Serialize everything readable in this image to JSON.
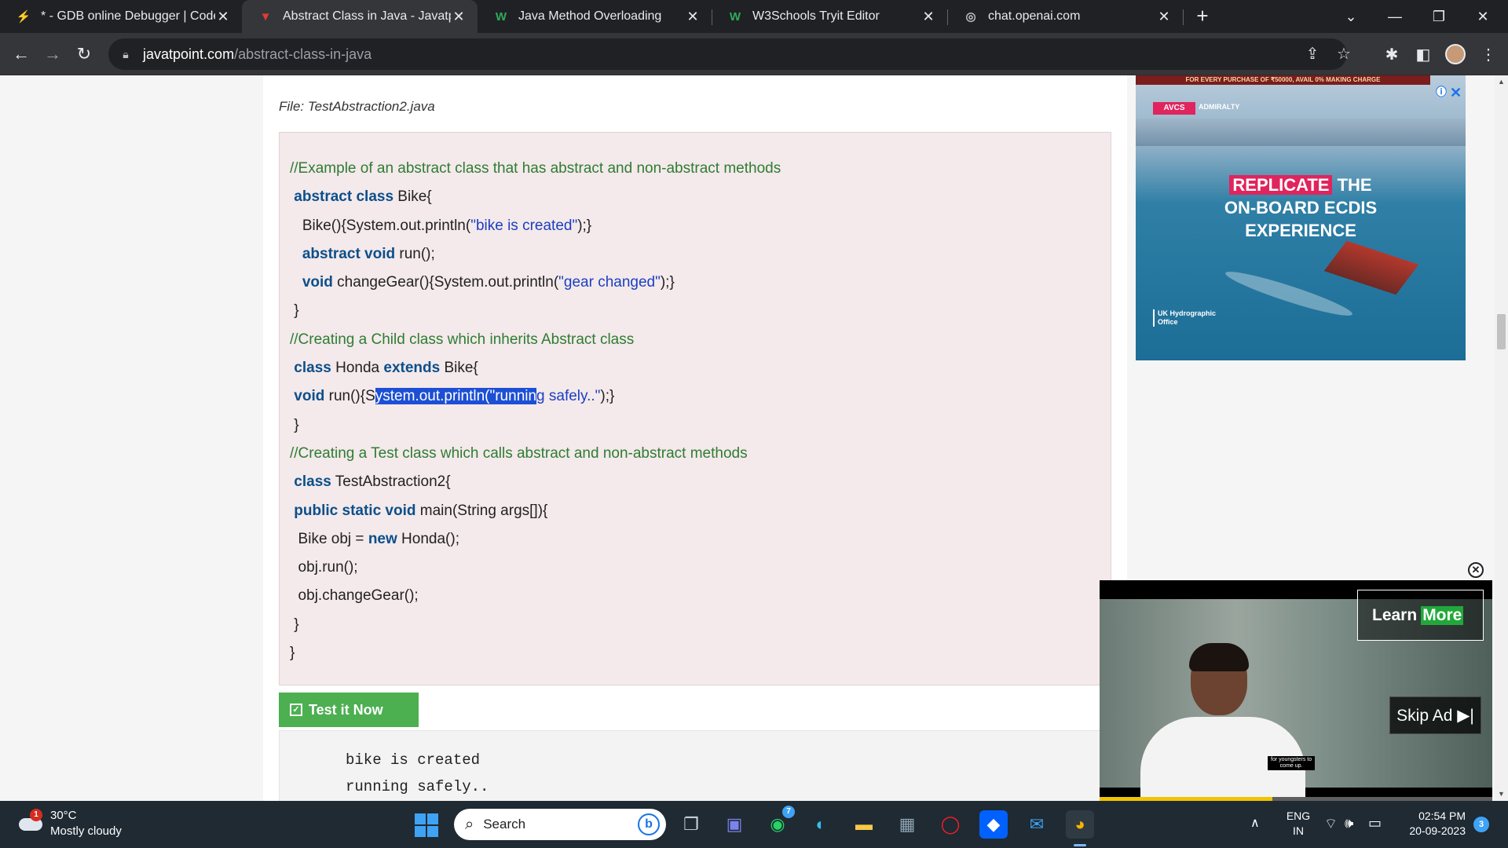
{
  "browser": {
    "tabs": [
      {
        "title": "* - GDB online Debugger | Code, Compile, Run",
        "icon": "lightning-icon",
        "active": false
      },
      {
        "title": "Abstract Class in Java - Javatpoint",
        "icon": "javatpoint-icon",
        "active": true
      },
      {
        "title": "Java Method Overloading",
        "icon": "w3schools-icon",
        "active": false
      },
      {
        "title": "W3Schools Tryit Editor",
        "icon": "w3schools-icon",
        "active": false
      },
      {
        "title": "chat.openai.com",
        "icon": "openai-icon",
        "active": false
      }
    ],
    "url_host": "javatpoint.com",
    "url_path": "/abstract-class-in-java"
  },
  "page": {
    "file_label": "File: TestAbstraction2.java",
    "code_lines": [
      [
        {
          "t": "//Example of an abstract class that has abstract and non-abstract methods",
          "c": "cm"
        }
      ],
      [
        {
          "t": " "
        },
        {
          "t": "abstract class",
          "c": "kw"
        },
        {
          "t": " Bike{"
        }
      ],
      [
        {
          "t": "   Bike(){System.out.println("
        },
        {
          "t": "\"bike is created\"",
          "c": "st"
        },
        {
          "t": ");}"
        }
      ],
      [
        {
          "t": "   "
        },
        {
          "t": "abstract void",
          "c": "kw"
        },
        {
          "t": " run();"
        }
      ],
      [
        {
          "t": "   "
        },
        {
          "t": "void",
          "c": "kw"
        },
        {
          "t": " changeGear(){System.out.println("
        },
        {
          "t": "\"gear changed\"",
          "c": "st"
        },
        {
          "t": ");}"
        }
      ],
      [
        {
          "t": " }"
        }
      ],
      [
        {
          "t": "//Creating a Child class which inherits Abstract class",
          "c": "cm"
        }
      ],
      [
        {
          "t": " "
        },
        {
          "t": "class",
          "c": "kw"
        },
        {
          "t": " Honda "
        },
        {
          "t": "extends",
          "c": "kw"
        },
        {
          "t": " Bike{"
        }
      ],
      [
        {
          "t": " "
        },
        {
          "t": "void",
          "c": "kw"
        },
        {
          "t": " run(){S"
        },
        {
          "t": "ystem.out.println(\"runnin",
          "c": "sel"
        },
        {
          "t": "g safely..\"",
          "c": "st"
        },
        {
          "t": ");}"
        }
      ],
      [
        {
          "t": " }"
        }
      ],
      [
        {
          "t": "//Creating a Test class which calls abstract and non-abstract methods",
          "c": "cm"
        }
      ],
      [
        {
          "t": " "
        },
        {
          "t": "class",
          "c": "kw"
        },
        {
          "t": " TestAbstraction2{"
        }
      ],
      [
        {
          "t": " "
        },
        {
          "t": "public static void",
          "c": "kw"
        },
        {
          "t": " main(String args[]){"
        }
      ],
      [
        {
          "t": "  Bike obj = "
        },
        {
          "t": "new",
          "c": "kw"
        },
        {
          "t": " Honda();"
        }
      ],
      [
        {
          "t": "  obj.run();"
        }
      ],
      [
        {
          "t": "  obj.changeGear();"
        }
      ],
      [
        {
          "t": " }"
        }
      ],
      [
        {
          "t": "}"
        }
      ]
    ],
    "test_button": "Test it Now",
    "output_lines": [
      "bike is created",
      "running safely.."
    ]
  },
  "ads": {
    "banner": {
      "top_strip": "FOR EVERY PURCHASE OF ₹50000, AVAIL 0% MAKING CHARGE",
      "logo": "AVCS",
      "logo_sub": "ADMIRALTY",
      "headline_highlight": "REPLICATE",
      "headline_rest_1": " THE",
      "headline_2": "ON-BOARD ECDIS",
      "headline_3": "EXPERIENCE",
      "footer_1": "UK Hydrographic",
      "footer_2": "Office",
      "adchoices": "ⓘ",
      "close": "✕"
    },
    "video": {
      "learn": "Learn",
      "more": "More",
      "skip": "Skip Ad ▶|",
      "caption_1": "for youngsters to",
      "caption_2": "come up.",
      "progress": 0.44,
      "close": "✕"
    }
  },
  "scroll": {
    "position": 0.34,
    "visible_fraction": 0.05
  },
  "taskbar": {
    "weather_temp": "30°C",
    "weather_desc": "Mostly cloudy",
    "weather_badge": "1",
    "search_placeholder": "Search",
    "whatsapp_count": "7",
    "lang_1": "ENG",
    "lang_2": "IN",
    "time": "02:54 PM",
    "date": "20-09-2023",
    "notifications": "3"
  },
  "colors": {
    "keyword": "#0b4f8a",
    "comment": "#2e7d32",
    "string": "#1a3fc2",
    "selection": "#1c4fd4",
    "test_button": "#4caf50",
    "code_bg": "#f4e9eb"
  }
}
